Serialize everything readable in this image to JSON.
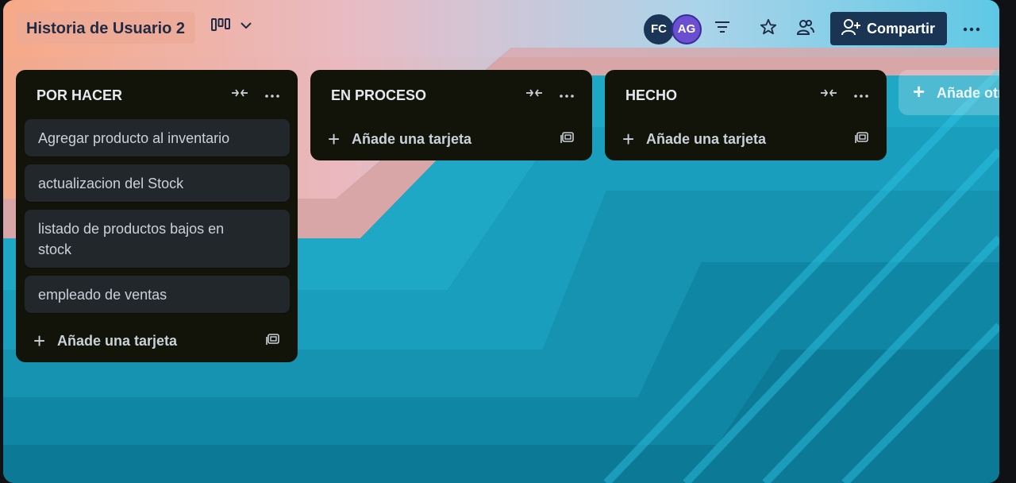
{
  "board": {
    "title": "Historia de Usuario 2",
    "members": [
      {
        "initials": "FC",
        "color": "#1a3556"
      },
      {
        "initials": "AG",
        "color": "#6b4fd1"
      }
    ],
    "share_label": "Compartir",
    "add_list_label": "Añade otra"
  },
  "lists": [
    {
      "title": "POR HACER",
      "cards": [
        "Agregar producto al inventario",
        "actualizacion del Stock",
        "listado de productos bajos en stock",
        "empleado de ventas"
      ],
      "add_card_label": "Añade una tarjeta"
    },
    {
      "title": "EN PROCESO",
      "cards": [],
      "add_card_label": "Añade una tarjeta"
    },
    {
      "title": "HECHO",
      "cards": [],
      "add_card_label": "Añade una tarjeta"
    }
  ],
  "icons": {
    "view": "board-view-icon",
    "chevron": "chevron-down-icon",
    "filter": "filter-icon",
    "star": "star-icon",
    "visibility": "team-visibility-icon",
    "share": "add-person-icon",
    "more": "more-icon",
    "collapse": "collapse-list-icon",
    "template": "card-template-icon"
  }
}
